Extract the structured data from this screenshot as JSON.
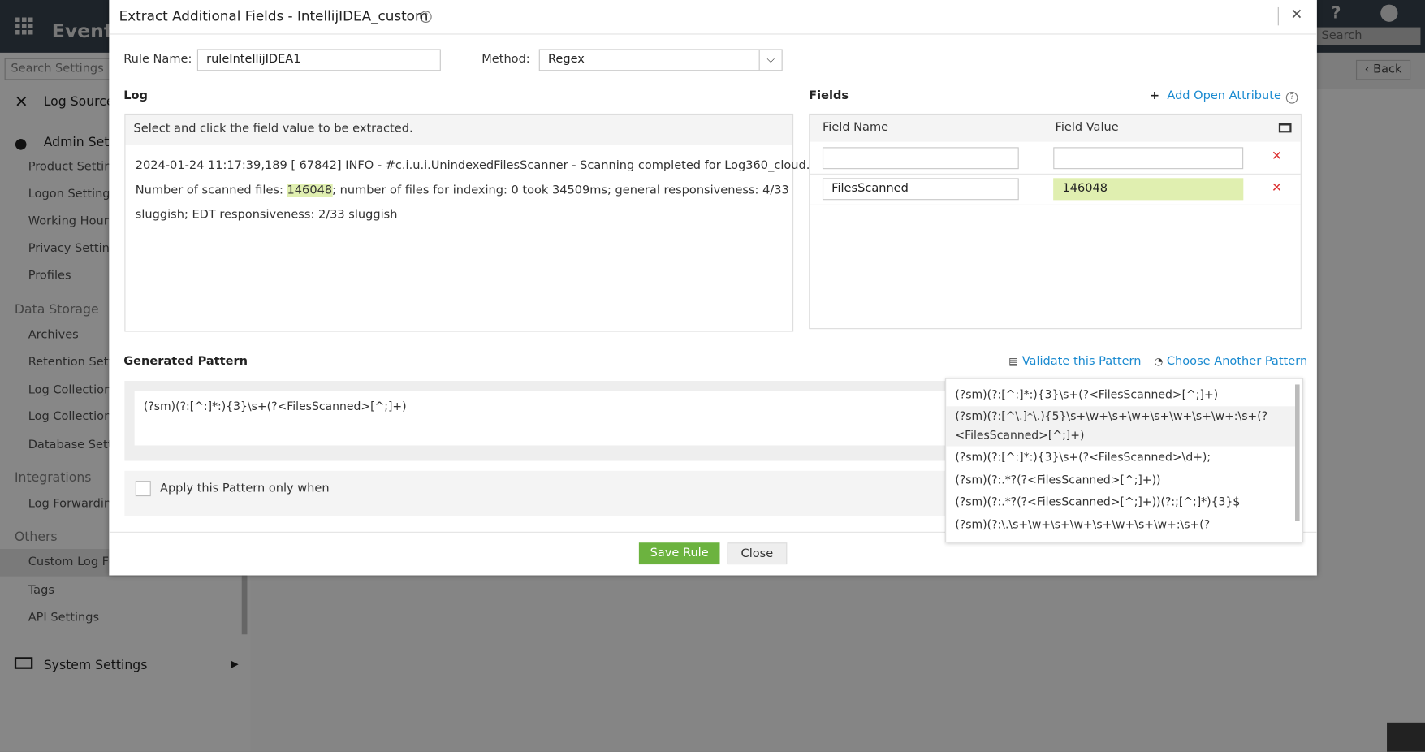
{
  "background": {
    "app_name": "EventL",
    "search_settings_placeholder": "Search Settings",
    "top_search_placeholder": "Search",
    "help": "?",
    "back_label": "Back",
    "sidebar": {
      "log_source": "Log Source C",
      "admin_settings": "Admin Setti",
      "admin_items": [
        "Product Setting",
        "Logon Settings",
        "Working Hour S",
        "Privacy Settings",
        "Profiles"
      ],
      "data_storage": "Data Storage",
      "data_items": [
        "Archives",
        "Retention Setti",
        "Log Collection",
        "Log Collection F",
        "Database Setti"
      ],
      "integrations": "Integrations",
      "integration_items": [
        "Log Forwarding"
      ],
      "others": "Others",
      "others_items": [
        "Custom Log Fo",
        "Tags",
        "API Settings"
      ],
      "system_settings": "System Settings"
    }
  },
  "modal": {
    "title": "Extract Additional Fields - IntellijIDEA_custom",
    "rule_name_label": "Rule Name:",
    "rule_name_value": "ruleIntellijIDEA1",
    "method_label": "Method:",
    "method_value": "Regex",
    "log": {
      "heading": "Log",
      "instruction": "Select and click the field value to be extracted.",
      "line1": "2024-01-24 11:17:39,189 [ 67842] INFO - #c.i.u.i.UnindexedFilesScanner - Scanning completed for Log360_cloud.",
      "line2_pre": "Number of scanned files: ",
      "line2_highlight": "146048",
      "line2_post": "; number of files for indexing: 0 took 34509ms; general responsiveness: 4/33",
      "line3": "sluggish; EDT responsiveness: 2/33 sluggish"
    },
    "fields": {
      "heading": "Fields",
      "add_open_attribute": "Add Open Attribute",
      "col_name": "Field Name",
      "col_value": "Field Value",
      "rows": [
        {
          "name": "",
          "value": ""
        },
        {
          "name": "FilesScanned",
          "value": "146048"
        }
      ],
      "highlight_color": "#e0efb0"
    },
    "pattern": {
      "heading": "Generated Pattern",
      "validate": "Validate this Pattern",
      "choose_another": "Choose Another Pattern",
      "value": "(?sm)(?:[^:]*:){3}\\s+(?<FilesScanned>[^;]+)",
      "apply_condition_label": "Apply this Pattern only when",
      "options": [
        "(?sm)(?:[^:]*:){3}\\s+(?<FilesScanned>[^;]+)",
        "(?sm)(?:[^\\.]*\\.){5}\\s+\\w+\\s+\\w+\\s+\\w+\\s+\\w+:\\s+(?",
        "<FilesScanned>[^;]+)",
        "(?sm)(?:[^:]*:){3}\\s+(?<FilesScanned>\\d+);",
        "(?sm)(?:.*?(?<FilesScanned>[^;]+))",
        "(?sm)(?:.*?(?<FilesScanned>[^;]+))(?:;[^;]*){3}$",
        "(?sm)(?:\\.\\s+\\w+\\s+\\w+\\s+\\w+\\s+\\w+:\\s+(?"
      ]
    },
    "save_label": "Save Rule",
    "close_label": "Close",
    "accent": "#6cb33f",
    "link_color": "#1a8ad0"
  }
}
